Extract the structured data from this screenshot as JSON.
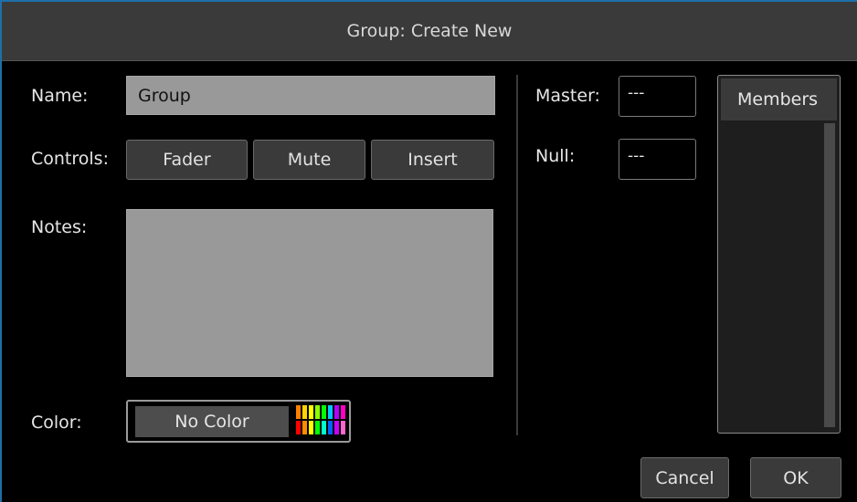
{
  "window": {
    "title": "Group: Create New"
  },
  "form": {
    "name_label": "Name:",
    "name_value": "Group",
    "controls_label": "Controls:",
    "controls": [
      "Fader",
      "Mute",
      "Insert"
    ],
    "notes_label": "Notes:",
    "notes_value": "",
    "color_label": "Color:",
    "color_button": "No Color",
    "swatch_colors": [
      "#ff7f00",
      "#ffd400",
      "#ffff00",
      "#8cff00",
      "#00ff00",
      "#00c8ff",
      "#b400ff",
      "#ff00c8",
      "#ff0000",
      "#ff8c00",
      "#ffff00",
      "#00ff00",
      "#00ffc8",
      "#0064ff",
      "#c800ff",
      "#ff66cc"
    ]
  },
  "assign": {
    "master_label": "Master:",
    "master_value": "---",
    "null_label": "Null:",
    "null_value": "---"
  },
  "members": {
    "header": "Members"
  },
  "footer": {
    "cancel": "Cancel",
    "ok": "OK"
  }
}
